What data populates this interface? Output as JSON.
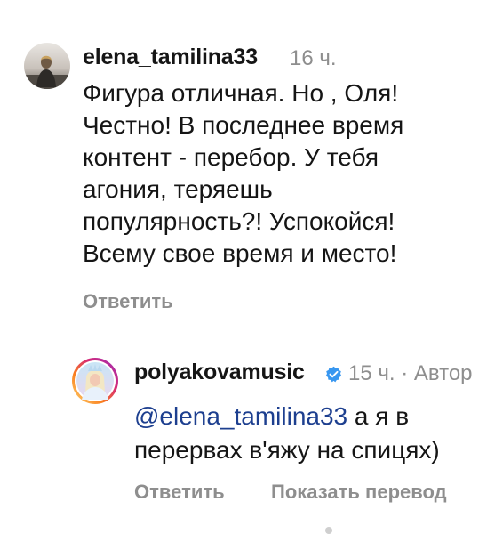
{
  "comments": [
    {
      "username": "elena_tamilina33",
      "time": "16 ч.",
      "text_lines": [
        "Фигура отличная. Но , Оля!",
        "Честно! В последнее время",
        "контент - перебор. У тебя",
        "агония, теряешь",
        "популярность?! Успокойся!",
        "Всему свое время и место!"
      ],
      "reply_label": "Ответить",
      "avatar_icon": "user-photo-avatar"
    },
    {
      "username": "polyakovamusic",
      "verified": true,
      "verified_icon": "verified-badge-icon",
      "time_author": "15 ч. · Автор",
      "mention": "@elena_tamilina33",
      "text_after_mention": " а я в",
      "text_line2": "перервах в'яжу на спицях)",
      "reply_label": "Ответить",
      "translate_label": "Показать перевод",
      "avatar_icon": "story-ring-avatar"
    }
  ],
  "colors": {
    "text": "#151515",
    "muted": "#8e8e8e",
    "mention": "#1d3f8f",
    "verified": "#3897f0",
    "background": "#ffffff"
  }
}
